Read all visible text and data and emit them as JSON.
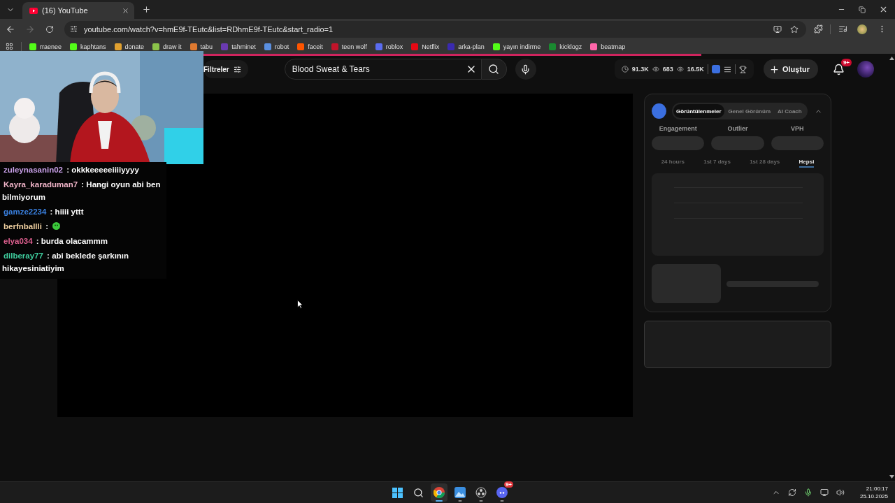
{
  "browser": {
    "tabs": [
      {
        "title": "(16) YouTube",
        "selected": true
      }
    ],
    "address": "youtube.com/watch?v=hmE9f-TEutc&list=RDhmE9f-TEutc&start_radio=1",
    "bookmarks": [
      {
        "label": "rraenee",
        "color": "#53fc18"
      },
      {
        "label": "kaphtans",
        "color": "#53fc18"
      },
      {
        "label": "donate",
        "color": "#e0a030"
      },
      {
        "label": "draw it",
        "color": "#8bc34a"
      },
      {
        "label": "tabu",
        "color": "#e07a30"
      },
      {
        "label": "tahminet",
        "color": "#6a3ab0"
      },
      {
        "label": "robot",
        "color": "#5a8fe0"
      },
      {
        "label": "faceit",
        "color": "#ff5500"
      },
      {
        "label": "teen wolf",
        "color": "#c0142a"
      },
      {
        "label": "roblox",
        "color": "#5a6cf0"
      },
      {
        "label": "Netflix",
        "color": "#e50914"
      },
      {
        "label": "arka-plan",
        "color": "#3a2ab0"
      },
      {
        "label": "yayın indirme",
        "color": "#53fc18"
      },
      {
        "label": "kicklogz",
        "color": "#1a8a30"
      },
      {
        "label": "beatmap",
        "color": "#ff66aa"
      }
    ]
  },
  "loading_bar": {
    "level": 0.79
  },
  "youtube": {
    "filters_label": "Filtreler",
    "search": {
      "value": "Blood Sweat & Tears"
    },
    "stats": [
      "91.3K",
      "683",
      "16.5K"
    ],
    "create_label": "Oluştur",
    "notification_badge": "9+"
  },
  "chat": [
    {
      "user": "zuleynasanin02",
      "message": ": okkkeeeeeiiiiyyyy",
      "color": "#c8a0e8",
      "kind": "text"
    },
    {
      "user": "Kayra_karaduman7",
      "message": ": Hangi oyun abi ben bilmiyorum",
      "color": "#f0b4c8",
      "kind": "text"
    },
    {
      "user": "gamze2234",
      "message": ": hiiii yttt",
      "color": "#3a80e0",
      "kind": "text"
    },
    {
      "user": "berfnballli",
      "message": ":",
      "color": "#f0d0a0",
      "kind": "emote"
    },
    {
      "user": "elya034",
      "message": ": burda olacammm",
      "color": "#e06090",
      "kind": "text"
    },
    {
      "user": "dilberay77",
      "message": ": abi beklede şarkının hikayesiniatiyim",
      "color": "#40d0a0",
      "kind": "text"
    }
  ],
  "analytics": {
    "tabs": [
      {
        "label": "Görüntülenmeler",
        "selected": true
      },
      {
        "label": "Genel Görünüm",
        "selected": false
      },
      {
        "label": "AI Coach",
        "selected": false
      }
    ],
    "metrics": [
      "Engagement",
      "Outlier",
      "VPH"
    ],
    "periods": [
      {
        "label": "24 hours",
        "selected": false
      },
      {
        "label": "1st 7 days",
        "selected": false
      },
      {
        "label": "1st 28 days",
        "selected": false
      },
      {
        "label": "Hepsi",
        "selected": true
      }
    ]
  },
  "taskbar": {
    "apps": [
      {
        "kind": "chrome",
        "selected": true
      },
      {
        "kind": "photos",
        "selected": false
      },
      {
        "kind": "obs",
        "selected": false
      },
      {
        "kind": "discord",
        "selected": false,
        "badge": "9+"
      }
    ],
    "time": "21:00:17",
    "date": "25.10.2025"
  }
}
